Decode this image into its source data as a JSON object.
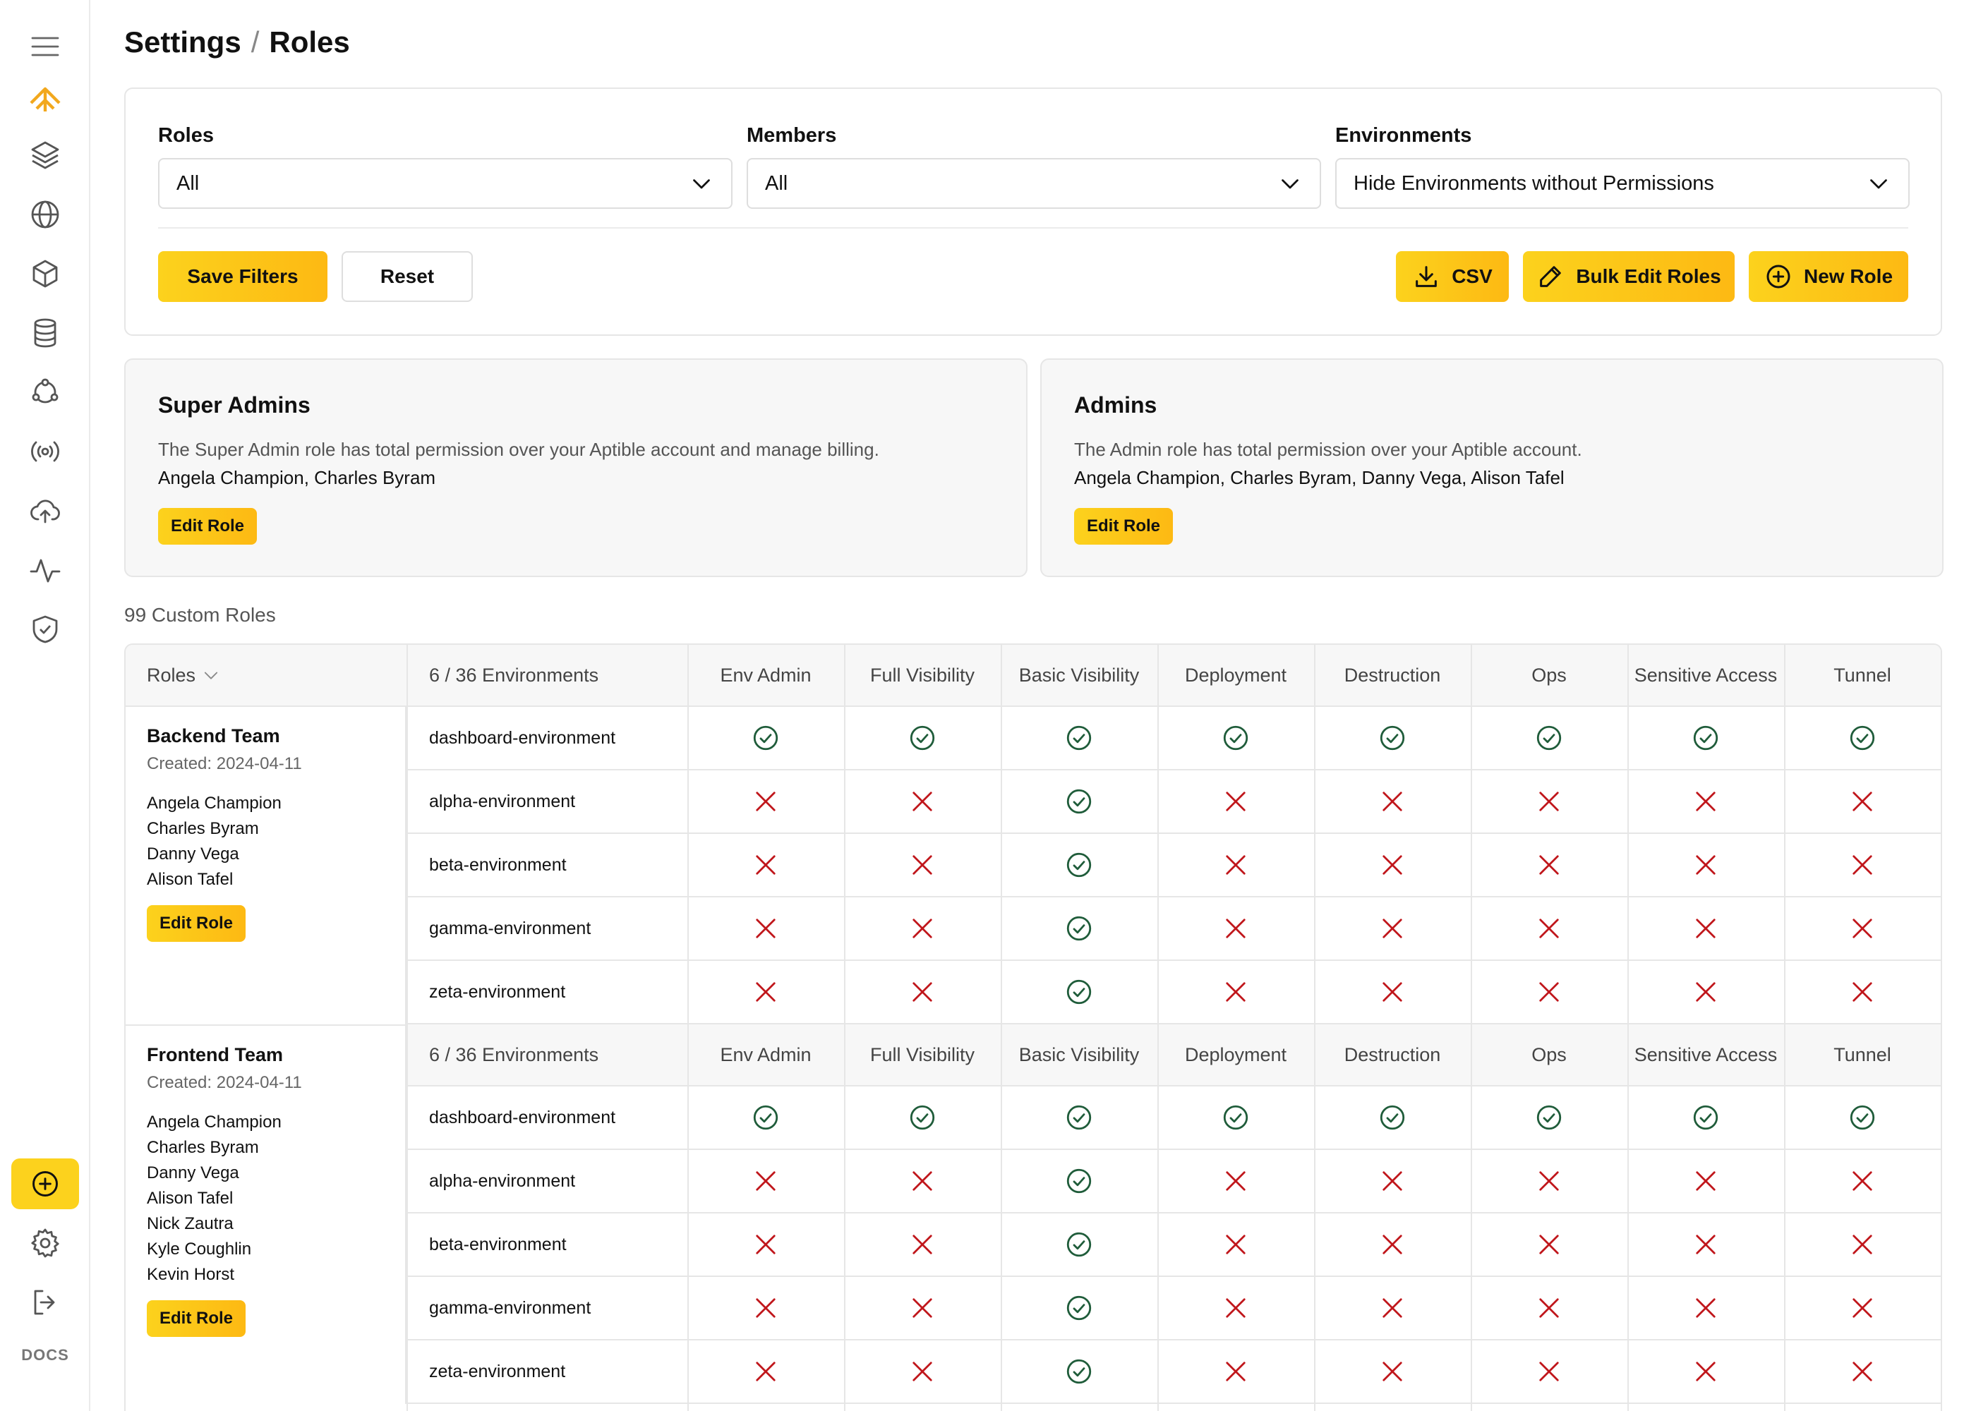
{
  "page": {
    "crumb_parent": "Settings",
    "crumb_sep": "/",
    "crumb_current": "Roles"
  },
  "sidebar": {
    "docs_label": "DOCS"
  },
  "filters": {
    "roles": {
      "label": "Roles",
      "value": "All"
    },
    "members": {
      "label": "Members",
      "value": "All"
    },
    "environments": {
      "label": "Environments",
      "value": "Hide Environments without Permissions"
    },
    "save_label": "Save Filters",
    "reset_label": "Reset",
    "csv_label": "CSV",
    "bulk_edit_label": "Bulk Edit Roles",
    "new_role_label": "New Role"
  },
  "super_admins": {
    "title": "Super Admins",
    "description": "The Super Admin role has total permission over your Aptible account and manage billing.",
    "members": "Angela Champion, Charles Byram",
    "edit_label": "Edit Role"
  },
  "admins": {
    "title": "Admins",
    "description": "The Admin role has total permission over your Aptible account.",
    "members": "Angela Champion, Charles Byram, Danny Vega, Alison Tafel",
    "edit_label": "Edit Role"
  },
  "custom_count": "99 Custom Roles",
  "table": {
    "roles_header": "Roles",
    "env_header": "6 / 36 Environments",
    "permissions": [
      "Env Admin",
      "Full Visibility",
      "Basic Visibility",
      "Deployment",
      "Destruction",
      "Ops",
      "Sensitive Access",
      "Tunnel"
    ],
    "roles": [
      {
        "name": "Backend Team",
        "created": "Created: 2024-04-11",
        "members": [
          "Angela Champion",
          "Charles Byram",
          "Danny Vega",
          "Alison Tafel"
        ],
        "edit_label": "Edit Role",
        "envs": [
          {
            "name": "dashboard-environment",
            "perms": [
              true,
              true,
              true,
              true,
              true,
              true,
              true,
              true
            ]
          },
          {
            "name": "alpha-environment",
            "perms": [
              false,
              false,
              true,
              false,
              false,
              false,
              false,
              false
            ]
          },
          {
            "name": "beta-environment",
            "perms": [
              false,
              false,
              true,
              false,
              false,
              false,
              false,
              false
            ]
          },
          {
            "name": "gamma-environment",
            "perms": [
              false,
              false,
              true,
              false,
              false,
              false,
              false,
              false
            ]
          },
          {
            "name": "zeta-environment",
            "perms": [
              false,
              false,
              true,
              false,
              false,
              false,
              false,
              false
            ]
          }
        ]
      },
      {
        "name": "Frontend Team",
        "created": "Created: 2024-04-11",
        "members": [
          "Angela Champion",
          "Charles Byram",
          "Danny Vega",
          "Alison Tafel",
          "Nick Zautra",
          "Kyle Coughlin",
          "Kevin Horst"
        ],
        "edit_label": "Edit Role",
        "envs": [
          {
            "name": "dashboard-environment",
            "perms": [
              true,
              true,
              true,
              true,
              true,
              true,
              true,
              true
            ]
          },
          {
            "name": "alpha-environment",
            "perms": [
              false,
              false,
              true,
              false,
              false,
              false,
              false,
              false
            ]
          },
          {
            "name": "beta-environment",
            "perms": [
              false,
              false,
              true,
              false,
              false,
              false,
              false,
              false
            ]
          },
          {
            "name": "gamma-environment",
            "perms": [
              false,
              false,
              true,
              false,
              false,
              false,
              false,
              false
            ]
          },
          {
            "name": "zeta-environment",
            "perms": [
              false,
              false,
              true,
              false,
              false,
              false,
              false,
              false
            ]
          }
        ]
      }
    ]
  },
  "colors": {
    "accent": "#fcd21d",
    "check": "#1f5c3a",
    "cross": "#c0161b",
    "logo": "#f2a81d"
  }
}
